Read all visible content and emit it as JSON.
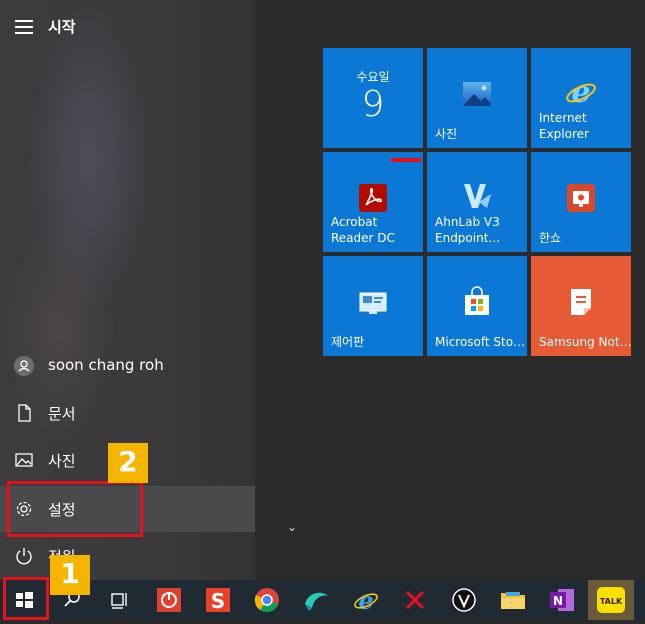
{
  "start": {
    "title": "시작"
  },
  "user": {
    "name": "soon chang roh"
  },
  "nav": [
    {
      "label": "문서",
      "icon": "document-icon"
    },
    {
      "label": "사진",
      "icon": "picture-icon"
    },
    {
      "label": "설정",
      "icon": "gear-icon"
    },
    {
      "label": "전원",
      "icon": "power-icon"
    }
  ],
  "calendar": {
    "day": "수요일",
    "date": "9"
  },
  "tiles": [
    {
      "label": "사진",
      "icon": "photos-icon"
    },
    {
      "label": "Internet\nExplorer",
      "icon": "ie-icon"
    },
    {
      "label": "Acrobat\nReader DC",
      "icon": "acrobat-icon"
    },
    {
      "label": "AhnLab V3\nEndpoint…",
      "icon": "ahnlab-icon"
    },
    {
      "label": "한쇼",
      "icon": "hanshow-icon"
    },
    {
      "label": "제어판",
      "icon": "control-panel-icon"
    },
    {
      "label": "Microsoft Sto…",
      "icon": "store-icon"
    },
    {
      "label": "Samsung Not…",
      "icon": "samsung-notes-icon"
    }
  ],
  "annotations": {
    "badge1": "1",
    "badge2": "2"
  },
  "colors": {
    "tile_blue": "#0a78d4",
    "samsung_orange": "#e65a36",
    "highlight_red": "#e8101a",
    "badge_yellow": "#f4b400"
  }
}
